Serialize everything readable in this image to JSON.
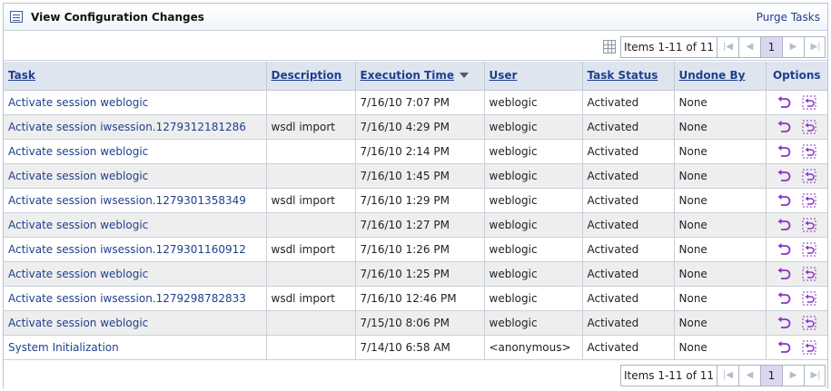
{
  "header": {
    "title": "View Configuration Changes",
    "purge_label": "Purge Tasks"
  },
  "pager": {
    "items_label": "Items 1-11 of 11",
    "current_page": "1"
  },
  "columns": [
    "Task",
    "Description",
    "Execution Time",
    "User",
    "Task Status",
    "Undone By",
    "Options"
  ],
  "rows": [
    {
      "task": "Activate session weblogic",
      "description": "",
      "time": "7/16/10 7:07 PM",
      "user": "weblogic",
      "status": "Activated",
      "undone_by": "None"
    },
    {
      "task": "Activate session iwsession.1279312181286",
      "description": "wsdl import",
      "time": "7/16/10 4:29 PM",
      "user": "weblogic",
      "status": "Activated",
      "undone_by": "None"
    },
    {
      "task": "Activate session weblogic",
      "description": "",
      "time": "7/16/10 2:14 PM",
      "user": "weblogic",
      "status": "Activated",
      "undone_by": "None"
    },
    {
      "task": "Activate session weblogic",
      "description": "",
      "time": "7/16/10 1:45 PM",
      "user": "weblogic",
      "status": "Activated",
      "undone_by": "None"
    },
    {
      "task": "Activate session iwsession.1279301358349",
      "description": "wsdl import",
      "time": "7/16/10 1:29 PM",
      "user": "weblogic",
      "status": "Activated",
      "undone_by": "None"
    },
    {
      "task": "Activate session weblogic",
      "description": "",
      "time": "7/16/10 1:27 PM",
      "user": "weblogic",
      "status": "Activated",
      "undone_by": "None"
    },
    {
      "task": "Activate session iwsession.1279301160912",
      "description": "wsdl import",
      "time": "7/16/10 1:26 PM",
      "user": "weblogic",
      "status": "Activated",
      "undone_by": "None"
    },
    {
      "task": "Activate session weblogic",
      "description": "",
      "time": "7/16/10 1:25 PM",
      "user": "weblogic",
      "status": "Activated",
      "undone_by": "None"
    },
    {
      "task": "Activate session iwsession.1279298782833",
      "description": "wsdl import",
      "time": "7/16/10 12:46 PM",
      "user": "weblogic",
      "status": "Activated",
      "undone_by": "None"
    },
    {
      "task": "Activate session weblogic",
      "description": "",
      "time": "7/15/10 8:06 PM",
      "user": "weblogic",
      "status": "Activated",
      "undone_by": "None"
    },
    {
      "task": "System Initialization",
      "description": "",
      "time": "7/14/10 6:58 AM",
      "user": "<anonymous>",
      "status": "Activated",
      "undone_by": "None"
    }
  ],
  "icons": {
    "title": "list-view-icon",
    "undo": "undo-icon",
    "undo_to": "undo-to-point-icon",
    "sort": "sort-descending-icon",
    "table_settings": "table-settings-icon"
  },
  "colors": {
    "link": "#1f3f8f",
    "header_bg": "#dfe5ef",
    "alt_row": "#eeeeee",
    "undo_icon": "#8a34c8",
    "current_page_bg": "#dcd7f0"
  }
}
